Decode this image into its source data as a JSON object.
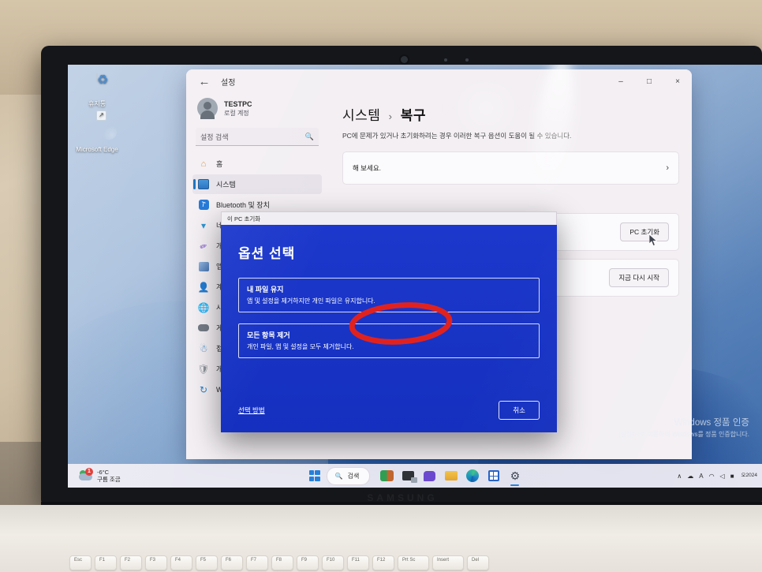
{
  "desktop": {
    "icons": [
      {
        "name": "recycle-bin",
        "label": "휴지통"
      },
      {
        "name": "microsoft-edge",
        "label": "Microsoft Edge"
      }
    ]
  },
  "settings_window": {
    "titlebar": {
      "back_icon": "back-arrow-icon",
      "title": "설정",
      "minimize": "–",
      "maximize": "□",
      "close": "×"
    },
    "account": {
      "name": "TESTPC",
      "type": "로컬 계정"
    },
    "search": {
      "placeholder": "설정 검색",
      "icon": "search-icon"
    },
    "nav_items": [
      {
        "label": "홈",
        "icon": "home-icon",
        "active": false
      },
      {
        "label": "시스템",
        "icon": "system-icon",
        "active": true
      },
      {
        "label": "Bluetooth 및 장치",
        "icon": "bluetooth-icon",
        "active": false
      },
      {
        "label": "네트워크 및 인터넷",
        "icon": "network-icon",
        "active": false
      },
      {
        "label": "개인 설정",
        "icon": "personalization-icon",
        "active": false
      },
      {
        "label": "앱",
        "icon": "apps-icon",
        "active": false
      },
      {
        "label": "계정",
        "icon": "accounts-icon",
        "active": false
      },
      {
        "label": "시간 및 언어",
        "icon": "time-language-icon",
        "active": false
      },
      {
        "label": "게임",
        "icon": "gaming-icon",
        "active": false
      },
      {
        "label": "접근성",
        "icon": "accessibility-icon",
        "active": false
      },
      {
        "label": "개인 정보 및 보안",
        "icon": "privacy-security-icon",
        "active": false
      },
      {
        "label": "Windows 업데이트",
        "icon": "windows-update-icon",
        "active": false
      }
    ],
    "content": {
      "breadcrumb_parent": "시스템",
      "breadcrumb_sep": "›",
      "breadcrumb_current": "복구",
      "subtitle": "PC에 문제가 있거나 초기화하려는 경우 이러한 복구 옵션이 도움이 될 수 있습니다.",
      "cards": [
        {
          "title": "해 보세요.",
          "chevron": "›"
        },
        {
          "title": "",
          "button": "PC 초기화"
        },
        {
          "title": "",
          "button": "지금 다시 시작"
        }
      ]
    }
  },
  "reset_dialog": {
    "window_title": "이 PC 초기화",
    "heading": "옵션 선택",
    "options": [
      {
        "title": "내 파일 유지",
        "description": "앱 및 설정을 제거하지만 개인 파일은 유지합니다."
      },
      {
        "title": "모든 항목 제거",
        "description": "개인 파일, 앱 및 설정을 모두 제거합니다."
      }
    ],
    "help_link": "선택 방법",
    "cancel_button": "취소",
    "accent_color": "#1a35c8",
    "annotation": {
      "shape": "red-ellipse",
      "color": "#e0221f",
      "targets_option_index": 1
    }
  },
  "watermark": {
    "line1": "Windows 정품 인증",
    "line2": "[설정]으로 이동하여 Windows를 정품 인증합니다."
  },
  "taskbar": {
    "weather": {
      "temperature": "-6°C",
      "condition": "구름 조금",
      "badge": "1",
      "icon": "weather-cloud-icon"
    },
    "start_label": "start-button",
    "search": {
      "placeholder": "검색",
      "icon": "search-icon"
    },
    "icons": [
      {
        "name": "widgets-icon",
        "active": false
      },
      {
        "name": "task-view-icon",
        "active": false
      },
      {
        "name": "chat-icon",
        "active": false
      },
      {
        "name": "file-explorer-icon",
        "active": false
      },
      {
        "name": "microsoft-edge-icon",
        "active": false
      },
      {
        "name": "microsoft-store-icon",
        "active": false
      },
      {
        "name": "settings-gear-icon",
        "active": true
      }
    ],
    "tray": {
      "chevron": "∧",
      "onedrive": "☁",
      "ime": "A",
      "wifi": "◠",
      "volume": "◁",
      "battery": "■",
      "clock_line1": "오",
      "clock_line2": "2024"
    }
  },
  "laptop": {
    "brand": "SAMSUNG",
    "function_keys": [
      "Esc",
      "F1",
      "F2",
      "F3",
      "F4",
      "F5",
      "F6",
      "F7",
      "F8",
      "F9",
      "F10",
      "F11",
      "F12",
      "Prt Sc",
      "Insert",
      "Del"
    ]
  }
}
